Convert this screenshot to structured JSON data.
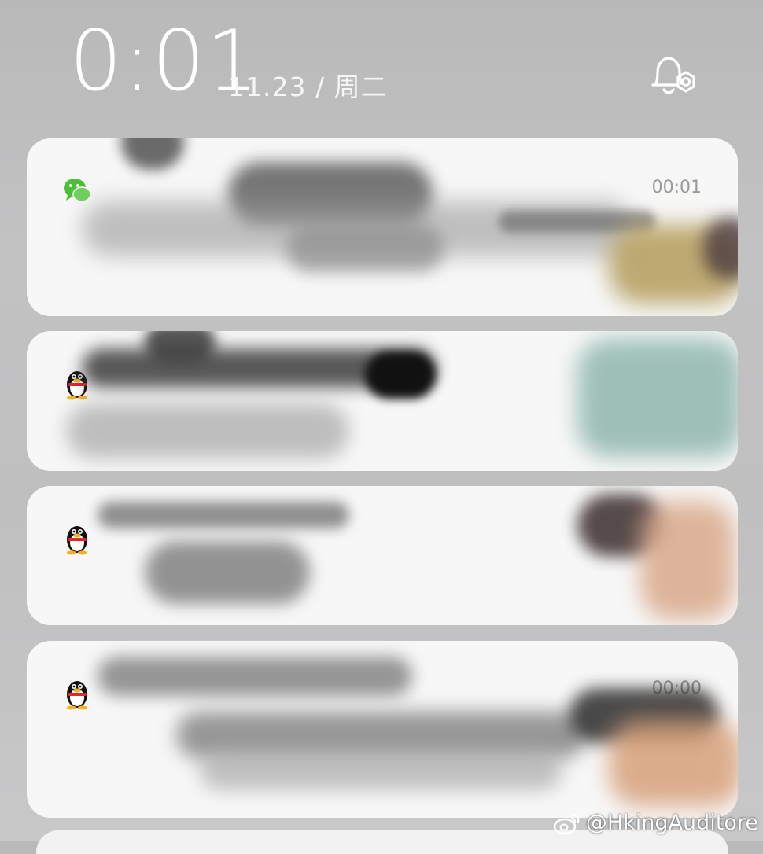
{
  "lock_screen": {
    "time": "0:01",
    "date": "11.23 / 周二",
    "bell_icon": "bell-settings-icon"
  },
  "notifications": [
    {
      "app_icon": "wechat-icon",
      "time": "00:01"
    },
    {
      "app_icon": "qq-penguin-icon",
      "time": ""
    },
    {
      "app_icon": "qq-penguin-icon",
      "time": ""
    },
    {
      "app_icon": "qq-penguin-icon",
      "time": "00:00"
    }
  ],
  "watermark": {
    "icon": "weibo-icon",
    "text": "@HkingAuditore"
  },
  "colors": {
    "wechat_green": "#4cbf3a",
    "card_background": "#f7f7f7",
    "clock_white": "#ffffff"
  }
}
